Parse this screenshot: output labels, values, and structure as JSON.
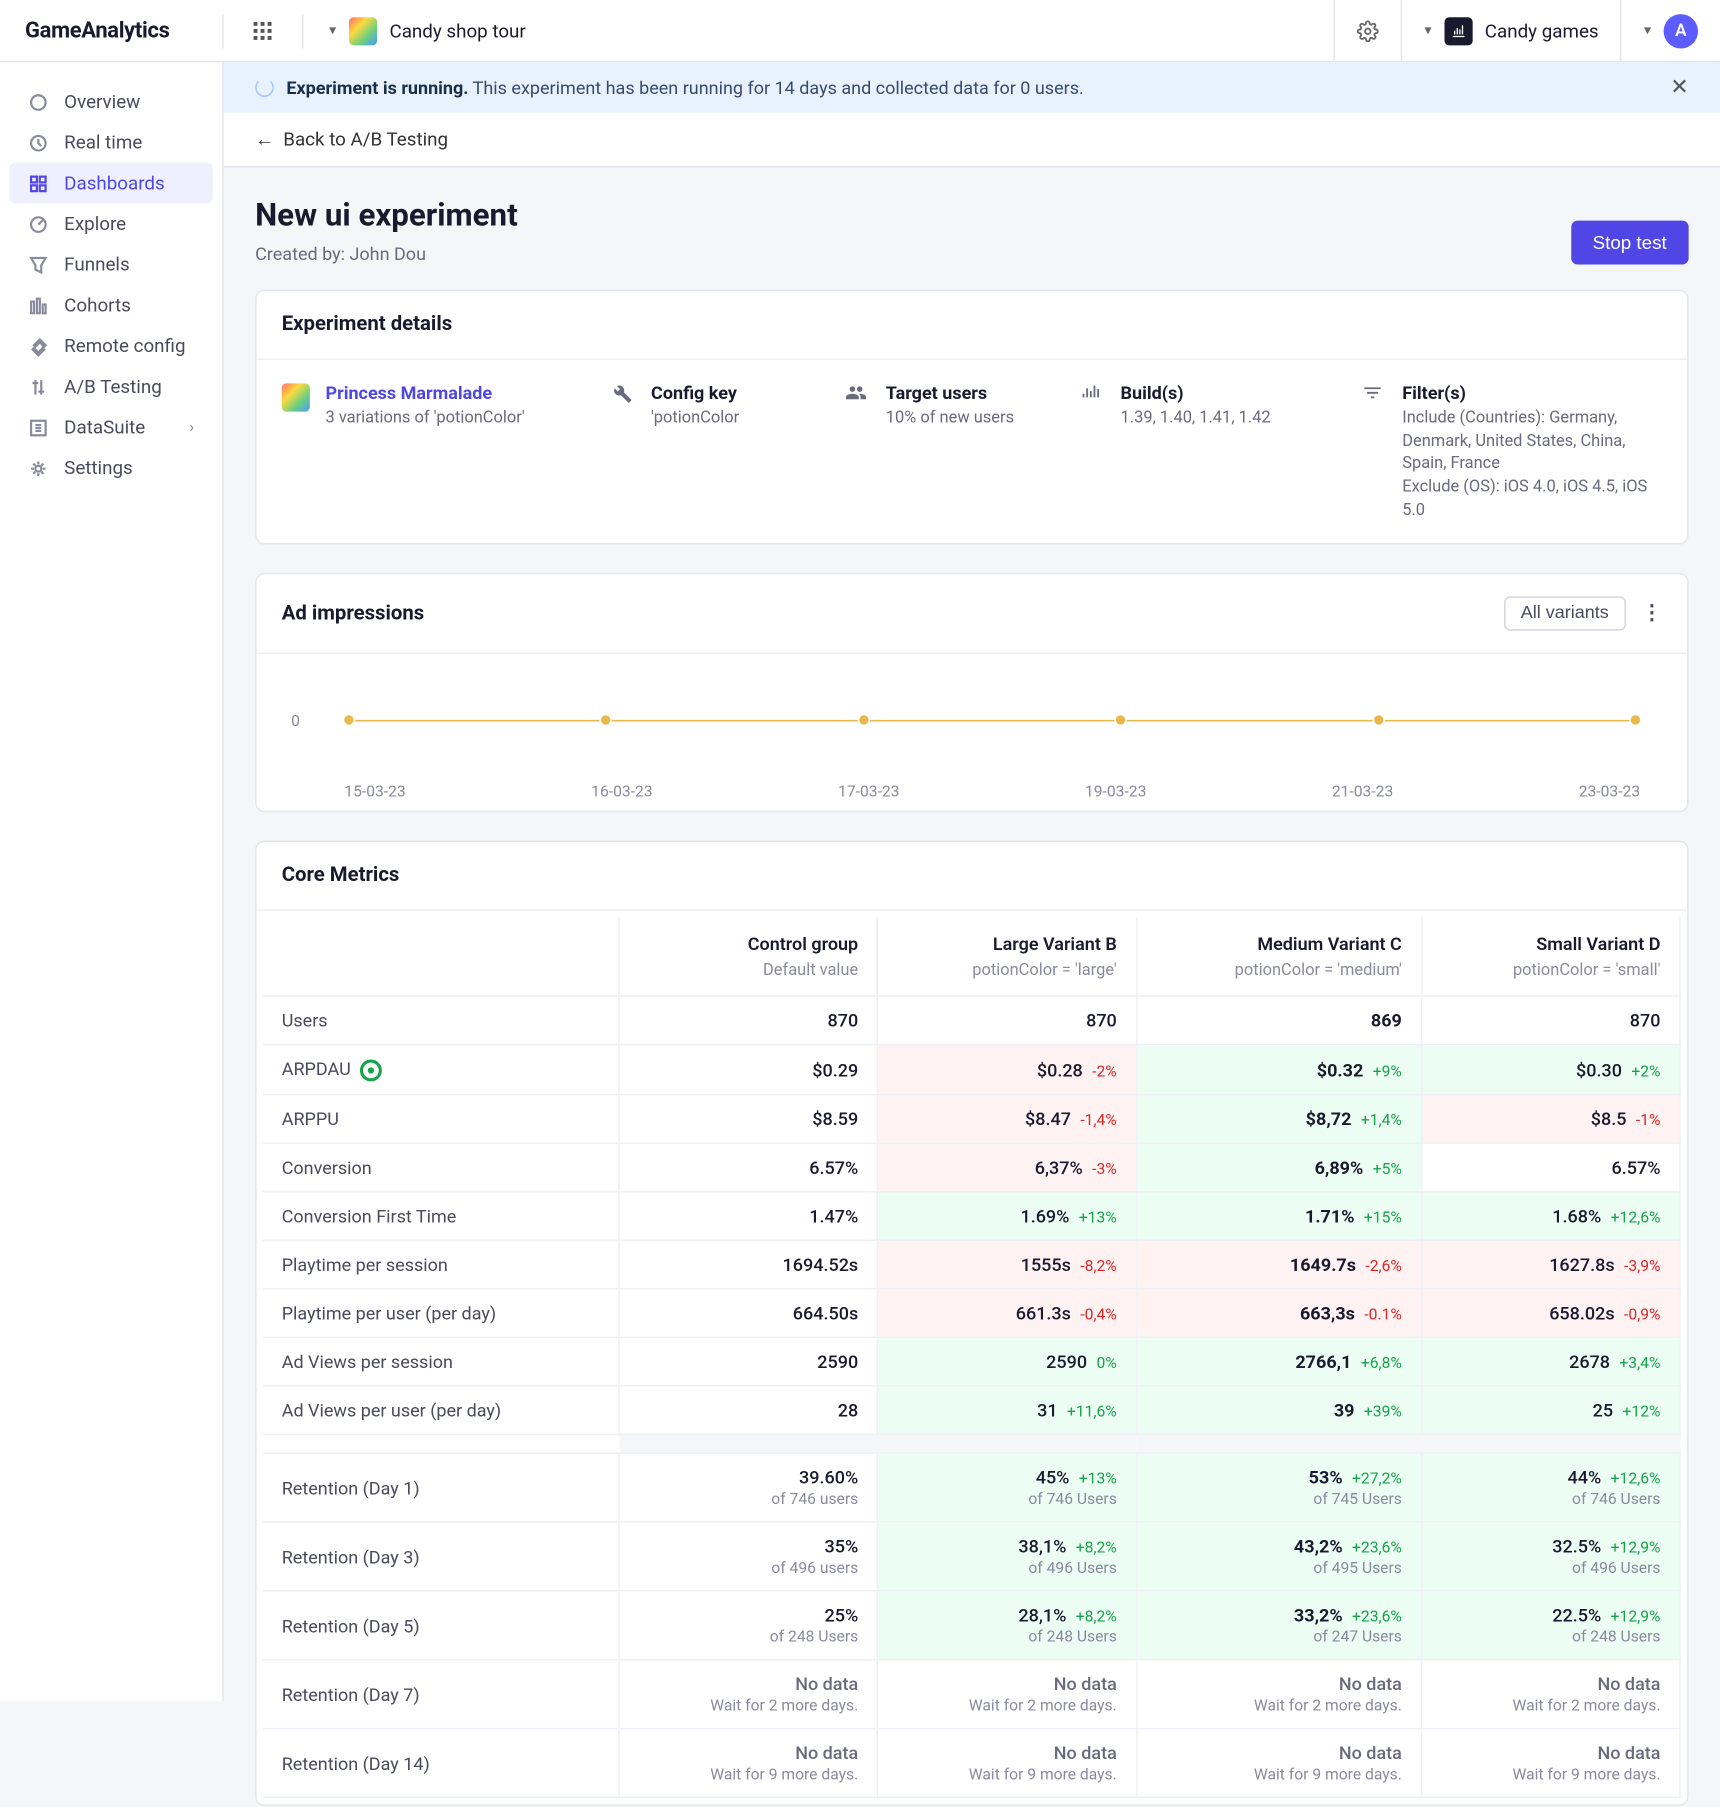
{
  "brand": "GameAnalytics",
  "project_selector": "Candy shop tour",
  "org_selector": "Candy games",
  "avatar_initial": "A",
  "sidebar": {
    "items": [
      {
        "label": "Overview"
      },
      {
        "label": "Real time"
      },
      {
        "label": "Dashboards",
        "active": true
      },
      {
        "label": "Explore"
      },
      {
        "label": "Funnels"
      },
      {
        "label": "Cohorts"
      },
      {
        "label": "Remote config"
      },
      {
        "label": "A/B Testing"
      },
      {
        "label": "DataSuite",
        "chevron": true
      },
      {
        "label": "Settings"
      }
    ]
  },
  "banner": {
    "strong": "Experiment is running.",
    "rest": "This experiment has been running for 14 days and collected data for 0 users."
  },
  "back_link": "Back to A/B Testing",
  "page_title": "New ui experiment",
  "created_by_label": "Created by:",
  "created_by_name": "John Dou",
  "stop_button": "Stop test",
  "exp_details": {
    "heading": "Experiment details",
    "game_name": "Princess Marmalade",
    "game_sub": "3 variations of 'potionColor'",
    "config_label": "Config key",
    "config_val": "'potionColor",
    "target_label": "Target users",
    "target_val": "10% of new users",
    "builds_label": "Build(s)",
    "builds_val": "1.39, 1.40, 1.41, 1.42",
    "filters_label": "Filter(s)",
    "filters_val1": "Include (Countries): Germany, Denmark, United States, China, Spain, France",
    "filters_val2": "Exclude (OS): iOS 4.0, iOS 4.5, iOS 5.0"
  },
  "ad_card": {
    "heading": "Ad impressions",
    "variant_button": "All variants"
  },
  "chart_data": {
    "type": "line",
    "title": "Ad impressions",
    "xlabel": "",
    "ylabel": "",
    "ylim": [
      0,
      0
    ],
    "categories": [
      "15-03-23",
      "16-03-23",
      "17-03-23",
      "19-03-23",
      "21-03-23",
      "23-03-23"
    ],
    "series": [
      {
        "name": "All variants",
        "values": [
          0,
          0,
          0,
          0,
          0,
          0
        ]
      }
    ],
    "y_ticks": [
      "0"
    ]
  },
  "core_metrics_heading": "Core Metrics",
  "columns": [
    {
      "title": "Control group",
      "sub": "Default value"
    },
    {
      "title": "Large Variant B",
      "sub": "potionColor = 'large'"
    },
    {
      "title": "Medium Variant C",
      "sub": "potionColor = 'medium'"
    },
    {
      "title": "Small Variant D",
      "sub": "potionColor = 'small'"
    }
  ],
  "rows": [
    {
      "label": "Users",
      "cells": [
        {
          "v": "870",
          "cls": "neu"
        },
        {
          "v": "870",
          "cls": "neu"
        },
        {
          "v": "869",
          "cls": "neu",
          "bold": true
        },
        {
          "v": "870",
          "cls": "neu"
        }
      ]
    },
    {
      "label": "ARPDAU",
      "goal": true,
      "cells": [
        {
          "v": "$0.29",
          "cls": "neu"
        },
        {
          "v": "$0.28",
          "d": "-2%",
          "cls": "neg"
        },
        {
          "v": "$0.32",
          "d": "+9%",
          "cls": "pos",
          "bold": true
        },
        {
          "v": "$0.30",
          "d": "+2%",
          "cls": "pos"
        }
      ]
    },
    {
      "label": "ARPPU",
      "cells": [
        {
          "v": "$8.59",
          "cls": "neu"
        },
        {
          "v": "$8.47",
          "d": "-1,4%",
          "cls": "neg"
        },
        {
          "v": "$8,72",
          "d": "+1,4%",
          "cls": "pos",
          "bold": true
        },
        {
          "v": "$8.5",
          "d": "-1%",
          "cls": "neg"
        }
      ]
    },
    {
      "label": "Conversion",
      "cells": [
        {
          "v": "6.57%",
          "cls": "neu"
        },
        {
          "v": "6,37%",
          "d": "-3%",
          "cls": "neg"
        },
        {
          "v": "6,89%",
          "d": "+5%",
          "cls": "pos",
          "bold": true
        },
        {
          "v": "6.57%",
          "cls": "neu"
        }
      ]
    },
    {
      "label": "Conversion First Time",
      "cells": [
        {
          "v": "1.47%",
          "cls": "neu"
        },
        {
          "v": "1.69%",
          "d": "+13%",
          "cls": "pos"
        },
        {
          "v": "1.71%",
          "d": "+15%",
          "cls": "pos",
          "bold": true
        },
        {
          "v": "1.68%",
          "d": "+12,6%",
          "cls": "pos"
        }
      ]
    },
    {
      "label": "Playtime per session",
      "cells": [
        {
          "v": "1694.52s",
          "cls": "neu"
        },
        {
          "v": "1555s",
          "d": "-8,2%",
          "cls": "neg"
        },
        {
          "v": "1649.7s",
          "d": "-2,6%",
          "cls": "neg",
          "bold": true
        },
        {
          "v": "1627.8s",
          "d": "-3,9%",
          "cls": "neg"
        }
      ]
    },
    {
      "label": "Playtime per user (per day)",
      "cells": [
        {
          "v": "664.50s",
          "cls": "neu"
        },
        {
          "v": "661.3s",
          "d": "-0,4%",
          "cls": "neg"
        },
        {
          "v": "663,3s",
          "d": "-0.1%",
          "cls": "neg",
          "bold": true
        },
        {
          "v": "658.02s",
          "d": "-0,9%",
          "cls": "neg"
        }
      ]
    },
    {
      "label": "Ad Views per session",
      "cells": [
        {
          "v": "2590",
          "cls": "neu"
        },
        {
          "v": "2590",
          "d": "0%",
          "cls": "pos"
        },
        {
          "v": "2766,1",
          "d": "+6,8%",
          "cls": "pos",
          "bold": true
        },
        {
          "v": "2678",
          "d": "+3,4%",
          "cls": "pos"
        }
      ]
    },
    {
      "label": "Ad Views per user (per day)",
      "cells": [
        {
          "v": "28",
          "cls": "neu"
        },
        {
          "v": "31",
          "d": "+11,6%",
          "cls": "pos"
        },
        {
          "v": "39",
          "d": "+39%",
          "cls": "pos",
          "bold": true
        },
        {
          "v": "25",
          "d": "+12%",
          "cls": "pos"
        }
      ]
    }
  ],
  "retention_rows": [
    {
      "label": "Retention (Day 1)",
      "cells": [
        {
          "v": "39.60%",
          "s": "of 746 users",
          "cls": "neu"
        },
        {
          "v": "45%",
          "d": "+13%",
          "s": "of 746 Users",
          "cls": "pos"
        },
        {
          "v": "53%",
          "d": "+27,2%",
          "s": "of 745 Users",
          "cls": "pos",
          "bold": true
        },
        {
          "v": "44%",
          "d": "+12,6%",
          "s": "of 746 Users",
          "cls": "pos"
        }
      ]
    },
    {
      "label": "Retention (Day 3)",
      "cells": [
        {
          "v": "35%",
          "s": "of 496 users",
          "cls": "neu"
        },
        {
          "v": "38,1%",
          "d": "+8,2%",
          "s": "of 496 Users",
          "cls": "pos"
        },
        {
          "v": "43,2%",
          "d": "+23,6%",
          "s": "of 495 Users",
          "cls": "pos",
          "bold": true
        },
        {
          "v": "32.5%",
          "d": "+12,9%",
          "s": "of 496 Users",
          "cls": "pos"
        }
      ]
    },
    {
      "label": "Retention (Day 5)",
      "cells": [
        {
          "v": "25%",
          "s": "of 248 Users",
          "cls": "neu"
        },
        {
          "v": "28,1%",
          "d": "+8,2%",
          "s": "of 248 Users",
          "cls": "pos"
        },
        {
          "v": "33,2%",
          "d": "+23,6%",
          "s": "of 247 Users",
          "cls": "pos",
          "bold": true
        },
        {
          "v": "22.5%",
          "d": "+12,9%",
          "s": "of 248 Users",
          "cls": "pos"
        }
      ]
    },
    {
      "label": "Retention (Day 7)",
      "cells": [
        {
          "v": "No data",
          "s": "Wait for 2 more days.",
          "cls": "neu",
          "nodata": true
        },
        {
          "v": "No data",
          "s": "Wait for 2 more days.",
          "cls": "neu",
          "nodata": true
        },
        {
          "v": "No data",
          "s": "Wait for 2 more days.",
          "cls": "neu",
          "nodata": true
        },
        {
          "v": "No data",
          "s": "Wait for 2 more days.",
          "cls": "neu",
          "nodata": true
        }
      ]
    },
    {
      "label": "Retention (Day 14)",
      "cells": [
        {
          "v": "No data",
          "s": "Wait for 9 more days.",
          "cls": "neu",
          "nodata": true
        },
        {
          "v": "No data",
          "s": "Wait for 9 more days.",
          "cls": "neu",
          "nodata": true
        },
        {
          "v": "No data",
          "s": "Wait for 9 more days.",
          "cls": "neu",
          "nodata": true
        },
        {
          "v": "No data",
          "s": "Wait for 9 more days.",
          "cls": "neu",
          "nodata": true
        }
      ]
    }
  ]
}
